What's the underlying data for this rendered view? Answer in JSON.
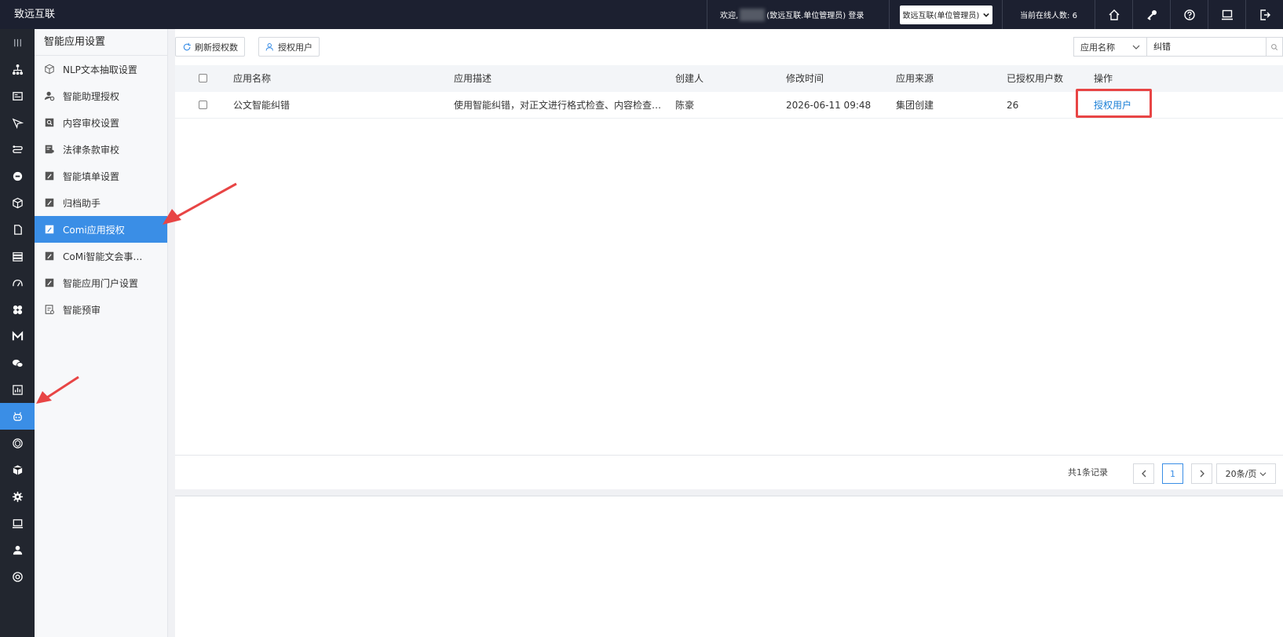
{
  "topbar": {
    "brand": "致远互联",
    "welcome_prefix": "欢迎,",
    "welcome_suffix": "(致远互联.单位管理员) 登录",
    "role_select": "致远互联(单位管理员)",
    "online": "当前在线人数: 6",
    "icons": [
      "home-icon",
      "key-icon",
      "help-icon",
      "monitor-icon",
      "logout-icon"
    ]
  },
  "sidebar": {
    "title": "智能应用设置",
    "items": [
      {
        "label": "NLP文本抽取设置",
        "icon": "cube-icon"
      },
      {
        "label": "智能助理授权",
        "icon": "user-gear-icon"
      },
      {
        "label": "内容审校设置",
        "icon": "search-doc-icon"
      },
      {
        "label": "法律条款审校",
        "icon": "doc-user-icon"
      },
      {
        "label": "智能填单设置",
        "icon": "edit-icon"
      },
      {
        "label": "归档助手",
        "icon": "edit-icon"
      },
      {
        "label": "Comi应用授权",
        "icon": "edit-icon"
      },
      {
        "label": "CoMi智能文会事…",
        "icon": "edit-icon"
      },
      {
        "label": "智能应用门户设置",
        "icon": "edit-icon"
      },
      {
        "label": "智能预审",
        "icon": "checklist-icon"
      }
    ]
  },
  "toolbar": {
    "refresh_label": "刷新授权数",
    "authorize_label": "授权用户",
    "filter_field": "应用名称",
    "search_value": "纠错"
  },
  "table": {
    "headers": [
      "应用名称",
      "应用描述",
      "创建人",
      "修改时间",
      "应用来源",
      "已授权用户数",
      "操作"
    ],
    "rows": [
      {
        "name": "公文智能纠错",
        "description": "使用智能纠错，对正文进行格式检查、内容检查…",
        "creator": "陈豪",
        "modified": "2026-06-11 09:48",
        "source": "集团创建",
        "authorized_count": "26",
        "action": "授权用户"
      }
    ]
  },
  "pager": {
    "total": "共1条记录",
    "current_page": "1",
    "page_size": "20条/页"
  },
  "colors": {
    "accent": "#3a8ee6",
    "topbar": "#1c2030",
    "highlight": "#e84545"
  }
}
